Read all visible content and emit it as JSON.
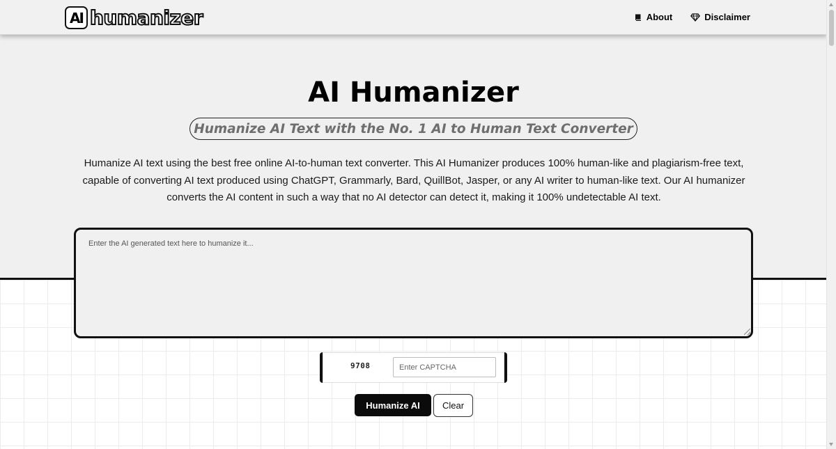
{
  "header": {
    "logo_badge": "AI",
    "logo_word": "humanizer",
    "nav": [
      {
        "label": "About",
        "icon": "book-icon"
      },
      {
        "label": "Disclaimer",
        "icon": "diamond-icon"
      }
    ]
  },
  "hero": {
    "title": "AI Humanizer",
    "subtitle": "Humanize AI Text with the No. 1 AI to Human Text Converter",
    "description": "Humanize AI text using the best free online AI-to-human text converter. This AI Humanizer produces 100% human-like and plagiarism-free text, capable of converting AI text produced using ChatGPT, Grammarly, Bard, QuillBot, Jasper, or any AI writer to human-like text. Our AI humanizer converts the AI content in such a way that no AI detector can detect it, making it 100% undetectable AI text."
  },
  "editor": {
    "placeholder": "Enter the AI generated text here to humanize it...",
    "value": ""
  },
  "captcha": {
    "code": "9708",
    "placeholder": "Enter CAPTCHA",
    "value": ""
  },
  "actions": {
    "humanize_label": "Humanize AI",
    "clear_label": "Clear"
  },
  "colors": {
    "accent": "#0b0b0b",
    "hero_background": "#f0f0f0",
    "subtitle_text": "#6e6e6e"
  }
}
